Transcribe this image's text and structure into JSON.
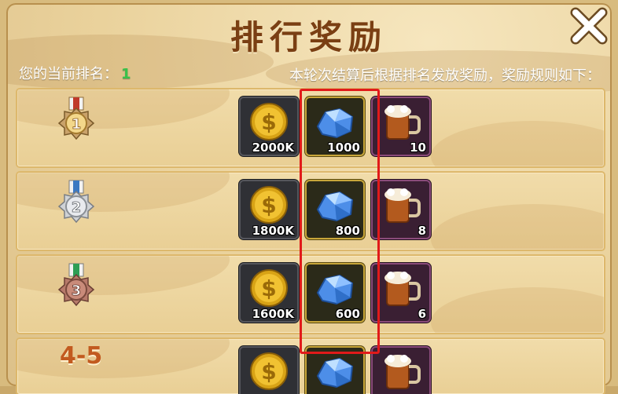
{
  "header": {
    "title": "排行奖励"
  },
  "rank": {
    "label": "您的当前排名：",
    "value": "1"
  },
  "rules_text": "本轮次结算后根据排名发放奖励，奖励规则如下：",
  "rows": [
    {
      "rank": "1",
      "medal_color": "#c0392b",
      "gold": "2000K",
      "gem": "1000",
      "beer": "10"
    },
    {
      "rank": "2",
      "medal_color": "#3b78c2",
      "gold": "1800K",
      "gem": "800",
      "beer": "8"
    },
    {
      "rank": "3",
      "medal_color": "#2e9e55",
      "gold": "1600K",
      "gem": "600",
      "beer": "6"
    },
    {
      "rank": "4-5",
      "gold": "",
      "gem": "",
      "beer": ""
    }
  ],
  "colors": {
    "highlight": "#e11a1a",
    "rank_value": "#3ac14a",
    "title": "#7a3f13"
  }
}
